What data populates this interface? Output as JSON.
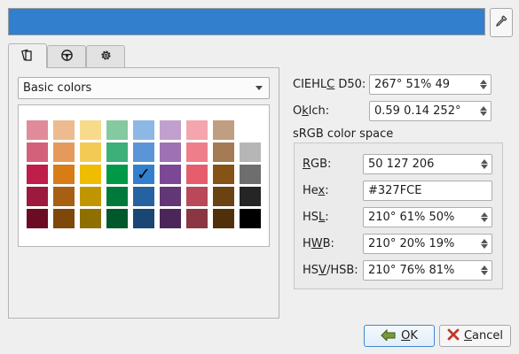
{
  "preview": {
    "color": "#327FCE"
  },
  "tabs": [
    {
      "icon": "palette-icon"
    },
    {
      "icon": "wheel-icon"
    },
    {
      "icon": "settings-icon"
    }
  ],
  "palette": {
    "selected": "Basic colors",
    "swatch_colors": [
      [
        "#E18B9A",
        "#EDBB8F",
        "#F7DA8A",
        "#84C9A0",
        "#8DB7E5",
        "#C1A0CD",
        "#F4A5AE",
        "#C09F81",
        "#FFFFFF"
      ],
      [
        "#D4617A",
        "#E59A5B",
        "#F3CB54",
        "#3DAF78",
        "#5B95D8",
        "#9E71B4",
        "#EE7F8A",
        "#A47B55",
        "#B6B6B6"
      ],
      [
        "#BE1E49",
        "#D87D15",
        "#EFBC00",
        "#009948",
        "#327FCE",
        "#7C4896",
        "#E65D6E",
        "#865215",
        "#6E6E6E"
      ],
      [
        "#9C1A3D",
        "#A76011",
        "#C09600",
        "#007A3A",
        "#25629F",
        "#633676",
        "#B94858",
        "#6B4212",
        "#252525"
      ],
      [
        "#6B0C24",
        "#7D4809",
        "#8F6F00",
        "#00592A",
        "#194675",
        "#4A2758",
        "#8B3642",
        "#50300A",
        "#000000"
      ]
    ],
    "checked_swatch_mark": "✓"
  },
  "ciehlc": {
    "label_prefix": "CIEHL",
    "label_u": "C",
    "label_suffix": " D50:",
    "value": "267°  51%  49"
  },
  "oklch": {
    "label_prefix": "O",
    "label_u": "k",
    "label_suffix": "lch:",
    "value": "0.59  0.14  252°"
  },
  "srgb": {
    "title": "sRGB color space",
    "rgb": {
      "label_u": "R",
      "label_rest": "GB:",
      "value": "50  127  206"
    },
    "hex": {
      "label_prefix": "He",
      "label_u": "x",
      "label_suffix": ":",
      "value": "#327FCE"
    },
    "hsl": {
      "label_prefix": "HS",
      "label_u": "L",
      "label_suffix": ":",
      "value": "210°  61%  50%"
    },
    "hwb": {
      "label_prefix": "H",
      "label_u": "W",
      "label_suffix": "B:",
      "value": "210°  20%  19%"
    },
    "hsv": {
      "label_prefix": "HS",
      "label_u": "V",
      "label_suffix": "/HSB:",
      "value": "210°  76%  81%"
    }
  },
  "buttons": {
    "ok": {
      "label_u": "O",
      "label_rest": "K",
      "accent": "#3F88D2"
    },
    "cancel": {
      "label_u": "C",
      "label_rest": "ancel"
    }
  }
}
